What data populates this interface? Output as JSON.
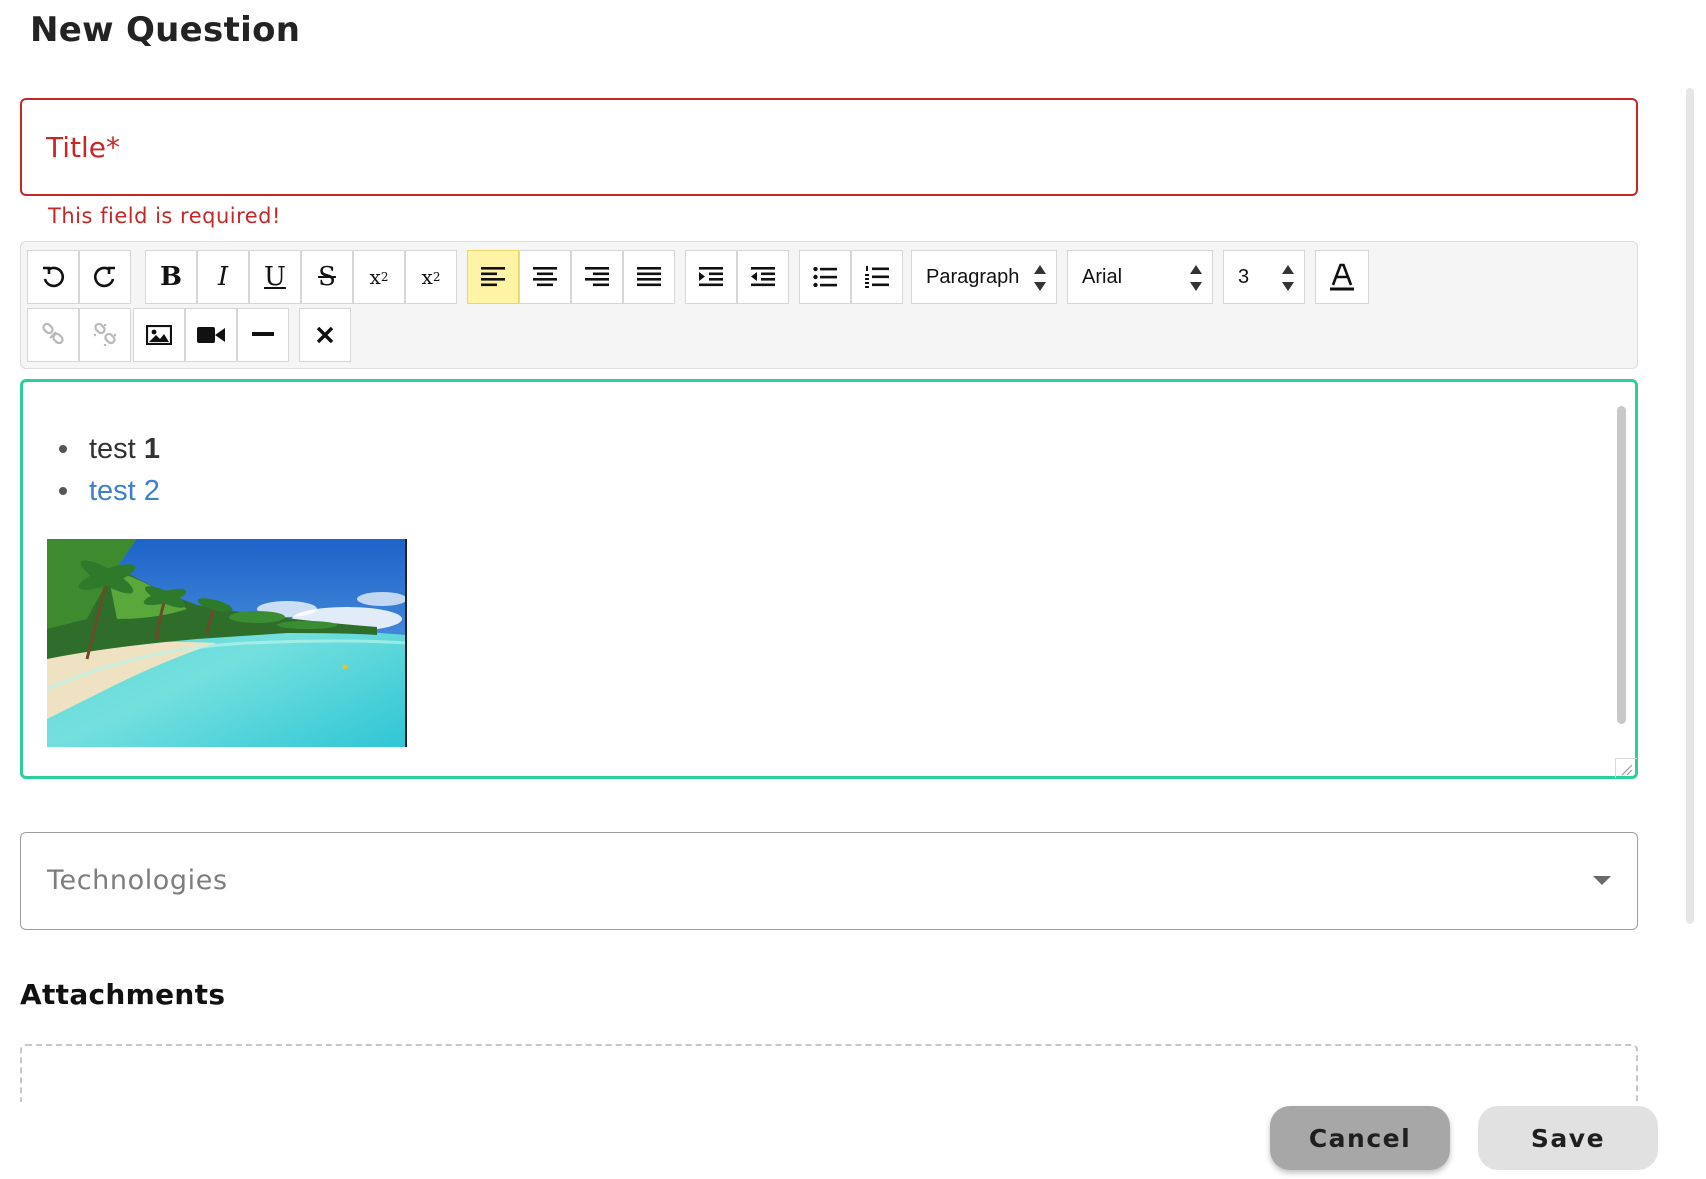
{
  "page": {
    "title": "New Question"
  },
  "title_field": {
    "placeholder": "Title*",
    "value": "",
    "error": "This field is required!",
    "error_color": "#c62828"
  },
  "toolbar": {
    "row1": [
      "undo-icon",
      "redo-icon",
      "bold-icon",
      "italic-icon",
      "underline-icon",
      "strikethrough-icon",
      "subscript-icon",
      "superscript-icon",
      "align-left-icon",
      "align-center-icon",
      "align-right-icon",
      "align-justify-icon",
      "indent-icon",
      "outdent-icon",
      "bullet-list-icon",
      "numbered-list-icon"
    ],
    "active": "align-left-icon",
    "format_select": "Paragraph",
    "font_select": "Arial",
    "size_select": "3",
    "row2": [
      "link-icon",
      "unlink-icon",
      "image-icon",
      "video-icon",
      "horizontal-rule-icon",
      "clear-format-icon"
    ],
    "disabled": [
      "link-icon",
      "unlink-icon"
    ]
  },
  "editor": {
    "border_color": "#2ccf9c",
    "list_items": [
      {
        "text": "test ",
        "bold": "1"
      },
      {
        "link_text": "test 2"
      }
    ],
    "image": "beach-image"
  },
  "technologies": {
    "placeholder": "Technologies"
  },
  "attachments": {
    "title": "Attachments"
  },
  "actions": {
    "cancel": "Cancel",
    "save": "Save"
  }
}
